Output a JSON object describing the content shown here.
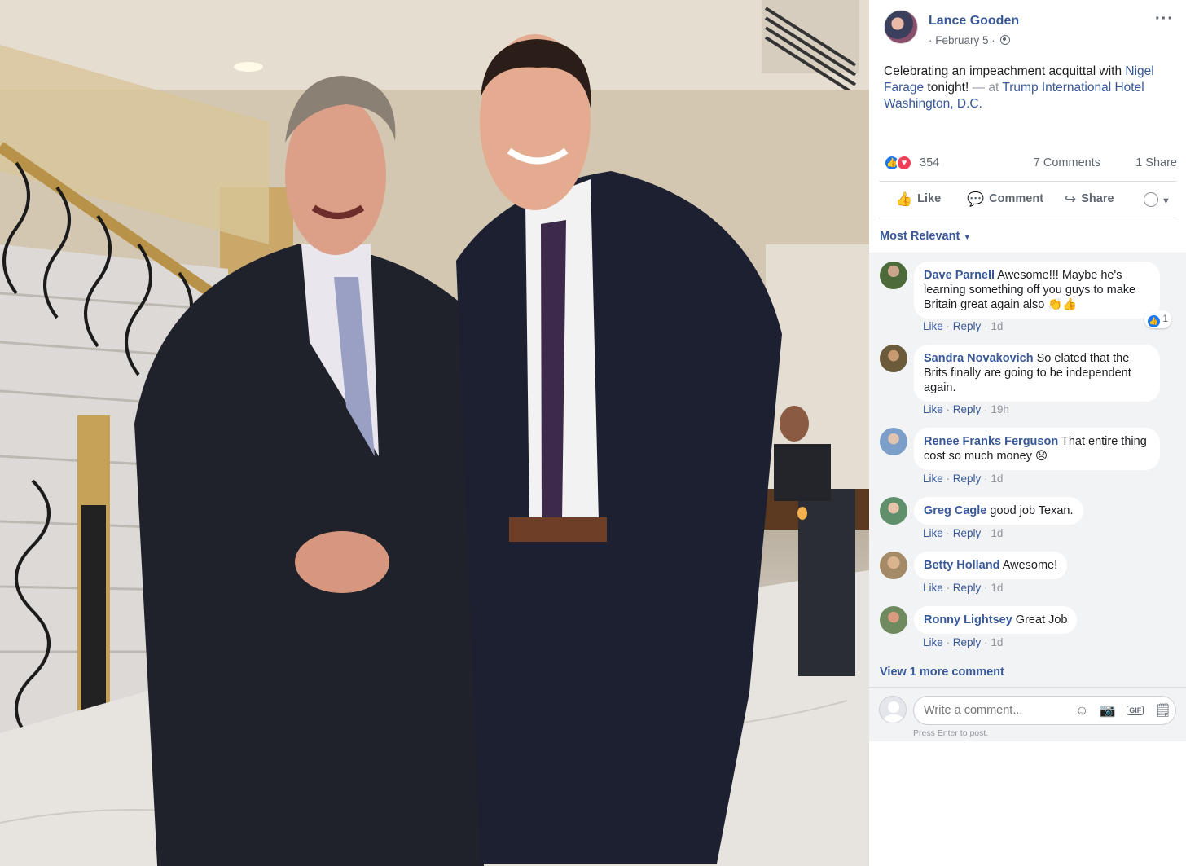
{
  "post": {
    "author": "Lance Gooden",
    "date": "· February 5 ·",
    "text_start": "Celebrating an impeachment acquittal with ",
    "tagged_person": "Nigel Farage",
    "text_mid": " tonight!",
    "at_prefix": " — at ",
    "location": "Trump International Hotel Washington, D.C.",
    "reaction_count": "354",
    "comments_count": "7 Comments",
    "shares_count": "1 Share"
  },
  "actions": {
    "like": "Like",
    "comment": "Comment",
    "share": "Share"
  },
  "sort_label": "Most Relevant",
  "comments": [
    {
      "name": "Dave Parnell",
      "text": "Awesome!!! Maybe he's learning something off you guys to make Britain great again also 👏👍",
      "like": "Like",
      "reply": "Reply",
      "time": "1d",
      "reactions": "1"
    },
    {
      "name": "Sandra Novakovich",
      "text": "So elated that the Brits finally are going to be independent again.",
      "like": "Like",
      "reply": "Reply",
      "time": "19h"
    },
    {
      "name": "Renee Franks Ferguson",
      "text": "That entire thing cost so much money 😞",
      "like": "Like",
      "reply": "Reply",
      "time": "1d"
    },
    {
      "name": "Greg Cagle",
      "text": "good job Texan.",
      "like": "Like",
      "reply": "Reply",
      "time": "1d"
    },
    {
      "name": "Betty Holland",
      "text": "Awesome!",
      "like": "Like",
      "reply": "Reply",
      "time": "1d"
    },
    {
      "name": "Ronny Lightsey",
      "text": "Great Job",
      "like": "Like",
      "reply": "Reply",
      "time": "1d"
    }
  ],
  "view_more": "View 1 more comment",
  "composer": {
    "placeholder": "Write a comment...",
    "hint": "Press Enter to post."
  },
  "icons": {
    "more": "more-options-icon",
    "globe": "globe-icon",
    "like": "thumbs-up-icon",
    "comment": "comment-bubble-icon",
    "share": "share-arrow-icon"
  },
  "colors": {
    "link": "#385898",
    "like_blue": "#1877f2",
    "love_red": "#f33e58",
    "comment_bg": "#f2f3f5"
  }
}
